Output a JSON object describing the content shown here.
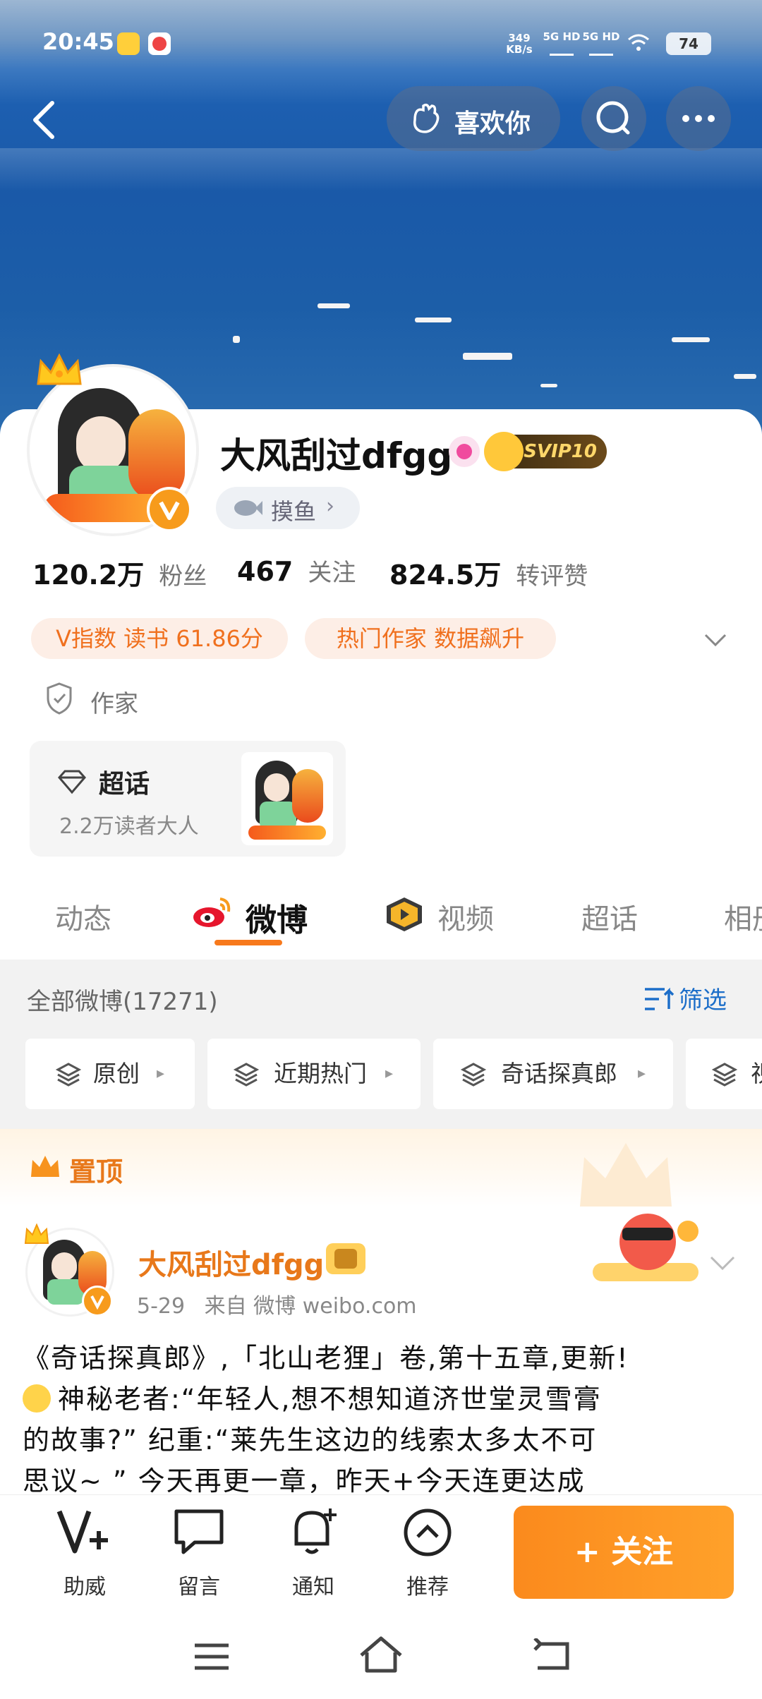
{
  "status_bar": {
    "time": "20:45",
    "net_speed_top": "349",
    "net_speed_bottom": "KB/s",
    "signal1": "5G HD",
    "signal2": "5G HD",
    "battery": "74"
  },
  "header": {
    "like_label": "喜欢你"
  },
  "profile": {
    "name": "大风刮过dfgg",
    "svip": "SVIP10",
    "mood_tag": "摸鱼",
    "stats": [
      {
        "value": "120.2万",
        "label": "粉丝"
      },
      {
        "value": "467",
        "label": "关注"
      },
      {
        "value": "824.5万",
        "label": "转评赞"
      }
    ],
    "tags": [
      "V指数 读书 61.86分",
      "热门作家 数据飙升"
    ],
    "verified": "作家",
    "supertopic": {
      "title": "超话",
      "subtitle": "2.2万读者大人"
    }
  },
  "tabs": [
    "动态",
    "微博",
    "视频",
    "超话",
    "相册"
  ],
  "feed": {
    "count_label": "全部微博(17271)",
    "filter_label": "筛选",
    "chips": [
      "原创",
      "近期热门",
      "奇话探真郎",
      "视频"
    ],
    "pinned_label": "置顶"
  },
  "post": {
    "author": "大风刮过dfgg",
    "date": "5-29",
    "source": "来自 微博 weibo.com",
    "line1": "《奇话探真郎》,「北山老狸」卷,第十五章,更新!",
    "line2": "神秘老者:“年轻人,想不想知道济世堂灵雪膏",
    "line3": "的故事?” 纪重:“莱先生这边的线索太多太不可",
    "line4": "思议~ ” 今天再更一章，昨天+今天连更达成"
  },
  "bottom_bar": {
    "items": [
      "助威",
      "留言",
      "通知",
      "推荐"
    ],
    "follow_label": "+ 关注"
  },
  "colors": {
    "accent_orange": "#f0701e",
    "follow_orange": "#fb8a1d",
    "pinned_orange": "#e8781a"
  }
}
